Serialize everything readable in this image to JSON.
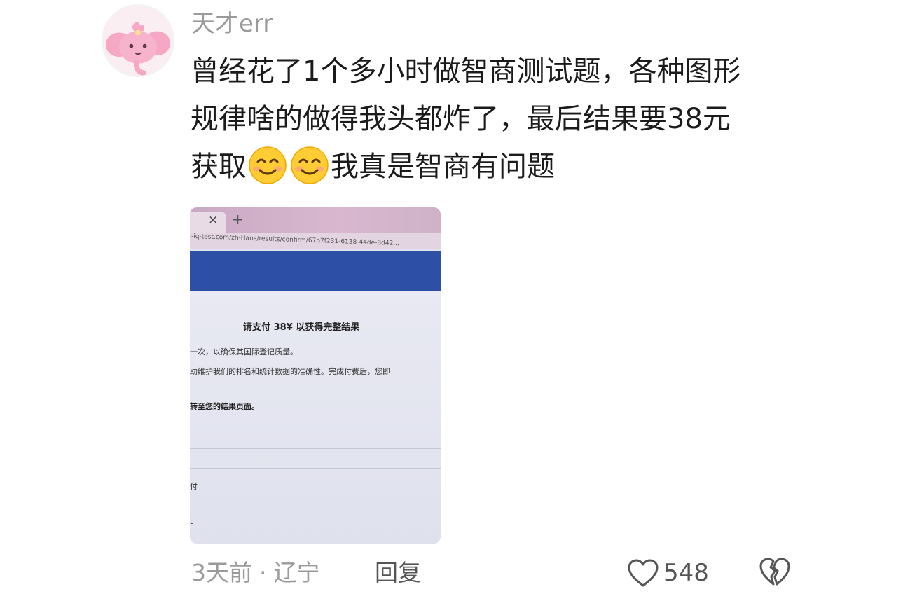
{
  "comment": {
    "username": "天才err",
    "text_line1": "曾经花了1个多小时做智商测试题，各种图形",
    "text_line2": "规律啥的做得我头都炸了，最后结果要38元",
    "text_line3_a": "获取",
    "text_line3_b": "我真是智商有问题",
    "emoji": "smiling-face-emoji"
  },
  "photo": {
    "tab_close": "×",
    "tab_new": "+",
    "url": "-iq-test.com/zh-Hans/results/confirm/67b7f231-6138-44de-8d42...",
    "heading": "请支付 38¥ 以获得完整结果",
    "line1": "一次，以确保其国际登记质量。",
    "line2": "助维护我们的排名和统计数据的准确性。完成付费后，您即",
    "line3": "转至您的结果页面。",
    "line4": "付",
    "line5": "t"
  },
  "footer": {
    "time": "3天前",
    "dot": "·",
    "location": "辽宁",
    "reply_label": "回复",
    "like_count": "548"
  },
  "colors": {
    "meta_gray": "#9a9a9a",
    "text_dark": "#1b1b1b",
    "photo_blue": "#2d4fa6"
  }
}
